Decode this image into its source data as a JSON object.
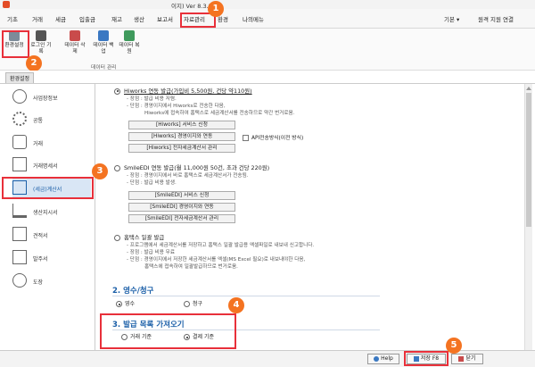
{
  "window": {
    "title": "이지) Ver 8.3.2"
  },
  "menu": {
    "items": [
      "기초",
      "거래",
      "세금",
      "입출금",
      "재고",
      "생산",
      "보고서",
      "자료관리",
      "환경",
      "나의메뉴"
    ],
    "right_basic": "기본 ▾",
    "remote": "원격 지원 연결"
  },
  "ribbon": {
    "buttons": [
      {
        "label": "환경설정",
        "icon": "gear-icon"
      },
      {
        "label": "로그인 기록",
        "icon": "lock-icon"
      },
      {
        "label": "데이터 삭제",
        "icon": "database-delete-icon"
      },
      {
        "label": "데이터 백업",
        "icon": "database-backup-icon"
      },
      {
        "label": "데이터 복원",
        "icon": "database-restore-icon"
      }
    ],
    "group_label": "데이터 관리"
  },
  "doc_tab": {
    "label": "환경설정"
  },
  "sidebar": {
    "items": [
      {
        "label": "사업장정보",
        "icon": "user-icon"
      },
      {
        "label": "공통",
        "icon": "gears-icon"
      },
      {
        "label": "거래",
        "icon": "trade-icon"
      },
      {
        "label": "거래명세서",
        "icon": "statement-icon"
      },
      {
        "label": "(세금)계산서",
        "icon": "tax-invoice-icon"
      },
      {
        "label": "생산지시서",
        "icon": "factory-icon"
      },
      {
        "label": "견적서",
        "icon": "quote-icon"
      },
      {
        "label": "발주서",
        "icon": "order-icon"
      },
      {
        "label": "도장",
        "icon": "stamp-icon"
      }
    ]
  },
  "options": {
    "hiworks": {
      "title": "Hiworks 연동 발급(가입비 5,500원, 건당 약110원)",
      "desc": [
        "- 장점 : 발급 비용 저렴.",
        "- 단점 : 경영이지에서 Hiworks로 전송한 다음,",
        "Hiworks에 접속하여 홈택스로 세금계산서를 전송하므로 약간 번거로움."
      ],
      "buttons": [
        "[Hiworks] 서비스 신청",
        "[Hiworks] 경영이지와 연동",
        "[Hiworks] 전자세금계산서 관리"
      ],
      "api_checkbox": "API전송방식(이전 방식)"
    },
    "smileedi": {
      "title": "SmileEDI 연동 발급(월 11,000원 50건, 초과 건당 220원)",
      "desc": [
        "- 장점 : 경영이지에서 바로 홈택스로 세금계산서가 전송됨.",
        "- 단점 : 발급 비용 발생."
      ],
      "buttons": [
        "[SmileEDI] 서비스 신청",
        "[SmileEDI] 경영이지와 연동",
        "[SmileEDI] 전자세금계산서 관리"
      ]
    },
    "hometax": {
      "title": "홈택스 일괄 발급",
      "desc": [
        "- 프로그램에서 세금계산서를 저장하고 홈택스 일괄 발급용 엑셀파일로 내보내 신고합니다.",
        "- 장점 : 발급 비용 무료",
        "- 단점 : 경영이지에서 저장한 세금계산서를 엑셀(MS Excel 필요)로 내보내야한 다음,",
        "홈택스에 접속하여 일괄발급하므로 번거로움."
      ]
    }
  },
  "section2": {
    "title": "2. 영수/청구",
    "opt1": "영수",
    "opt2": "청구"
  },
  "section3": {
    "title": "3. 발급 목록 가져오기",
    "opt1": "거래 기준",
    "opt2": "결제 기준"
  },
  "bottom": {
    "help": "Help",
    "save": "저장 F8",
    "close": "닫기"
  },
  "badges": [
    "1",
    "2",
    "3",
    "4",
    "5"
  ],
  "colors": {
    "highlight": "#e8303a",
    "badge": "#f47321",
    "section": "#1b5fa8"
  }
}
